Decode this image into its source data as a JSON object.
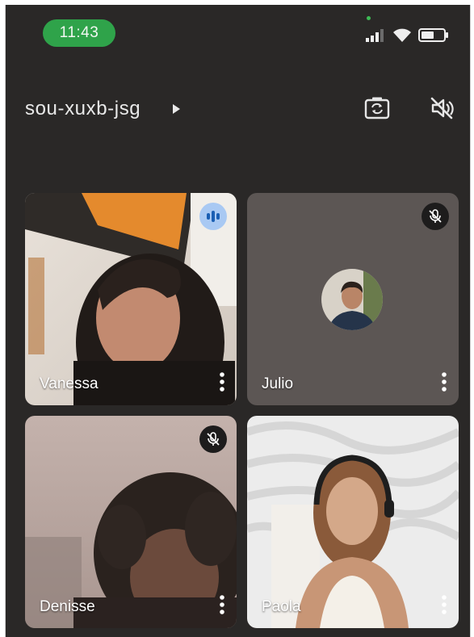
{
  "status_bar": {
    "time": "11:43",
    "clock_color": "#2fa34a",
    "icons": [
      "signal-icon",
      "wifi-icon",
      "battery-icon"
    ]
  },
  "header": {
    "meeting_code": "sou-xuxb-jsg",
    "icons": [
      "caret-right-icon",
      "switch-camera-icon",
      "speaker-off-icon"
    ]
  },
  "participants": [
    {
      "name": "Vanessa",
      "status": "speaking",
      "video": "on"
    },
    {
      "name": "Julio",
      "status": "muted",
      "video": "off"
    },
    {
      "name": "Denisse",
      "status": "muted",
      "video": "on"
    },
    {
      "name": "Paola",
      "status": "unmuted",
      "video": "on"
    }
  ],
  "colors": {
    "background": "#2a2827",
    "speaking_badge": "#a9c9f3",
    "muted_badge": "#1d1c1c",
    "avatar_tile": "#5c5654"
  }
}
